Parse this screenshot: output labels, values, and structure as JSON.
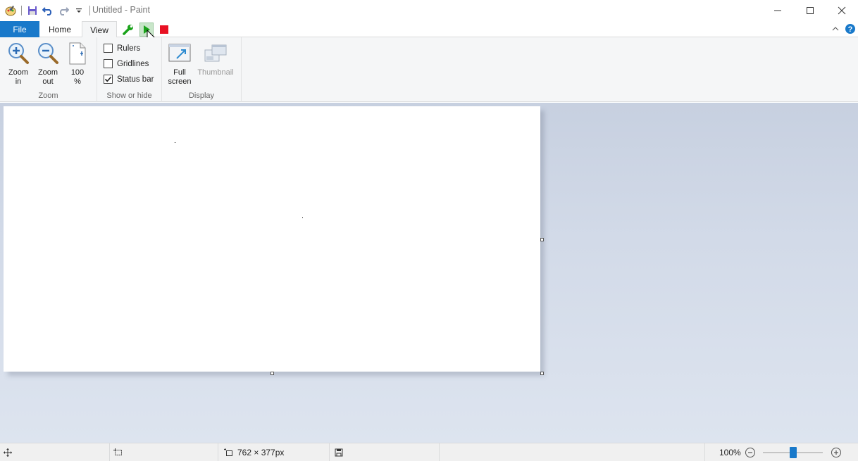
{
  "window": {
    "title": "Untitled - Paint",
    "controls": {
      "minimize": "minimize",
      "maximize": "maximize",
      "close": "close"
    }
  },
  "quick_access": {
    "icons": [
      "paint-app-icon",
      "save-icon",
      "undo-icon",
      "redo-icon",
      "customize-dropdown-icon"
    ]
  },
  "tabs": {
    "file": "File",
    "home": "Home",
    "view": "View",
    "active": "View"
  },
  "toolbar_extras": {
    "icons": [
      "wrench-icon",
      "play-icon",
      "stop-icon"
    ],
    "colors": {
      "wrench": "#1aa31a",
      "play": "#1aa31a",
      "stop": "#e81123"
    }
  },
  "ribbon": {
    "zoom_group": {
      "label": "Zoom",
      "zoom_in": {
        "line1": "Zoom",
        "line2": "in"
      },
      "zoom_out": {
        "line1": "Zoom",
        "line2": "out"
      },
      "actual": {
        "line1": "100",
        "line2": "%"
      }
    },
    "show_hide_group": {
      "label": "Show or hide",
      "rulers": {
        "label": "Rulers",
        "checked": false
      },
      "gridlines": {
        "label": "Gridlines",
        "checked": false
      },
      "status_bar": {
        "label": "Status bar",
        "checked": true
      }
    },
    "display_group": {
      "label": "Display",
      "full_screen": {
        "line1": "Full",
        "line2": "screen"
      },
      "thumbnail": {
        "label": "Thumbnail",
        "enabled": false
      }
    }
  },
  "status": {
    "canvas_size": "762 × 377px",
    "zoom_level": "100%",
    "zoom_fraction": 0.5
  },
  "colors": {
    "accent": "#1979ca",
    "workspace": "#d2dae8"
  }
}
